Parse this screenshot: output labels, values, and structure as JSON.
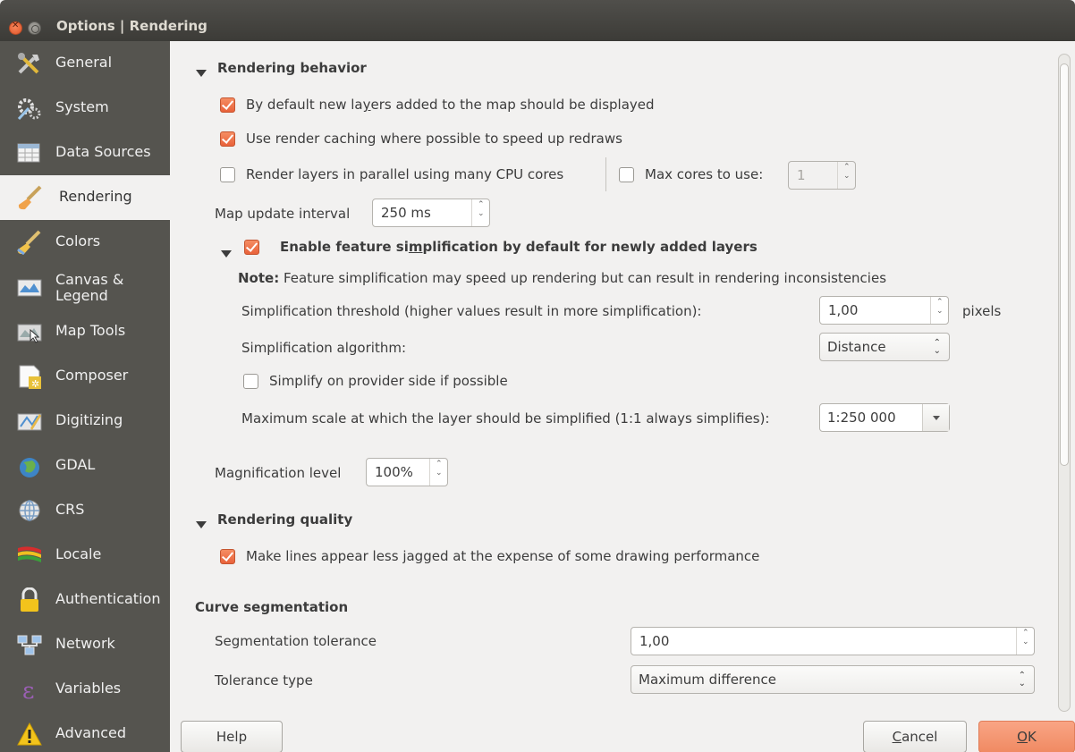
{
  "window": {
    "title": "Options | Rendering"
  },
  "sidebar": {
    "items": [
      {
        "label": "General",
        "icon": "tools-icon"
      },
      {
        "label": "System",
        "icon": "gears-icon"
      },
      {
        "label": "Data Sources",
        "icon": "table-icon"
      },
      {
        "label": "Rendering",
        "icon": "paintbrush-icon",
        "active": true
      },
      {
        "label": "Colors",
        "icon": "color-brush-icon"
      },
      {
        "label": "Canvas &",
        "label2": "Legend",
        "icon": "canvas-icon"
      },
      {
        "label": "Map Tools",
        "icon": "map-tools-icon"
      },
      {
        "label": "Composer",
        "icon": "composer-icon"
      },
      {
        "label": "Digitizing",
        "icon": "digitizing-icon"
      },
      {
        "label": "GDAL",
        "icon": "globe-icon"
      },
      {
        "label": "CRS",
        "icon": "crs-globe-icon"
      },
      {
        "label": "Locale",
        "icon": "flag-icon"
      },
      {
        "label": "Authentication",
        "icon": "lock-icon"
      },
      {
        "label": "Network",
        "icon": "network-icon"
      },
      {
        "label": "Variables",
        "icon": "epsilon-icon"
      },
      {
        "label": "Advanced",
        "icon": "warning-icon"
      }
    ]
  },
  "rendering_behavior": {
    "title": "Rendering behavior",
    "default_displayed": {
      "label_pre": "By default new la",
      "label_u": "y",
      "label_post": "ers added to the map should be displayed",
      "checked": true
    },
    "render_caching": {
      "label": "Use render caching where possible to speed up redraws",
      "checked": true
    },
    "parallel": {
      "label": "Render layers in parallel using many CPU cores",
      "checked": false
    },
    "max_cores": {
      "label": "Max cores to use:",
      "checked": false,
      "value": "1"
    },
    "map_update": {
      "label": "Map update interval",
      "value": "250 ms"
    },
    "simplification": {
      "title_pre": "Enable feature si",
      "title_u": "m",
      "title_post": "plification by default for newly added layers",
      "checked": true,
      "note_bold": "Note:",
      "note_text": " Feature simplification may speed up rendering but can result in rendering inconsistencies",
      "threshold_label": "Simplification threshold (higher values result in more simplification):",
      "threshold_value": "1,00",
      "threshold_unit": "pixels",
      "algorithm_label": "Simplification algorithm:",
      "algorithm_value": "Distance",
      "provider_side": {
        "label": "Simplify on provider side if possible",
        "checked": false
      },
      "max_scale_label": "Maximum scale at which the layer should be simplified (1:1 always simplifies):",
      "max_scale_value": "1:250 000"
    },
    "magnification": {
      "label": "Magnification level",
      "value": "100%"
    }
  },
  "rendering_quality": {
    "title": "Rendering quality",
    "antialias": {
      "label": "Make lines appear less jagged at the expense of some drawing performance",
      "checked": true
    }
  },
  "curve_segmentation": {
    "title": "Curve segmentation",
    "tolerance_label": "Segmentation tolerance",
    "tolerance_value": "1,00",
    "type_label": "Tolerance type",
    "type_value": "Maximum difference"
  },
  "buttons": {
    "help": "Help",
    "cancel_u": "C",
    "cancel_rest": "ancel",
    "ok_u": "O",
    "ok_rest": "K"
  },
  "colors": {
    "accent": "#e9623a",
    "sidebar_bg": "#55544f",
    "titlebar_bg": "#3c3b37"
  }
}
